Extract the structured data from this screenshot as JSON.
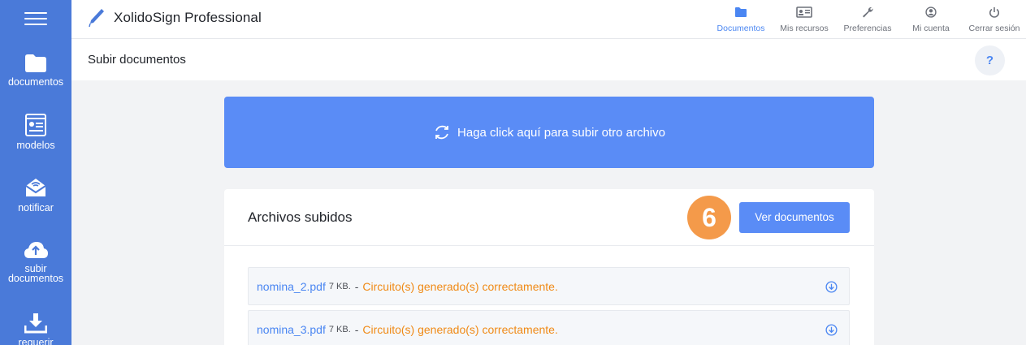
{
  "app": {
    "title": "XolidoSign Professional"
  },
  "sidebar": {
    "items": [
      {
        "label": "documentos"
      },
      {
        "label": "modelos"
      },
      {
        "label": "notificar"
      },
      {
        "label": "subir documentos"
      },
      {
        "label": "requerir"
      }
    ]
  },
  "topnav": {
    "items": [
      {
        "label": "Documentos"
      },
      {
        "label": "Mis recursos"
      },
      {
        "label": "Preferencias"
      },
      {
        "label": "Mi cuenta"
      },
      {
        "label": "Cerrar sesión"
      }
    ],
    "active": "Documentos"
  },
  "page": {
    "title": "Subir documentos",
    "help": "?"
  },
  "upload": {
    "label": "Haga click aquí para subir otro archivo"
  },
  "files_card": {
    "title": "Archivos subidos",
    "step": "6",
    "button": "Ver documentos",
    "files": [
      {
        "name": "nomina_2.pdf",
        "size": "7 KB.",
        "sep": "-",
        "status": "Circuito(s) generado(s) correctamente."
      },
      {
        "name": "nomina_3.pdf",
        "size": "7 KB.",
        "sep": "-",
        "status": "Circuito(s) generado(s) correctamente."
      }
    ]
  },
  "colors": {
    "sidebar": "#4a7ad9",
    "accent": "#5a8cf6",
    "status": "#f08a16",
    "badge": "#f49a4a"
  }
}
